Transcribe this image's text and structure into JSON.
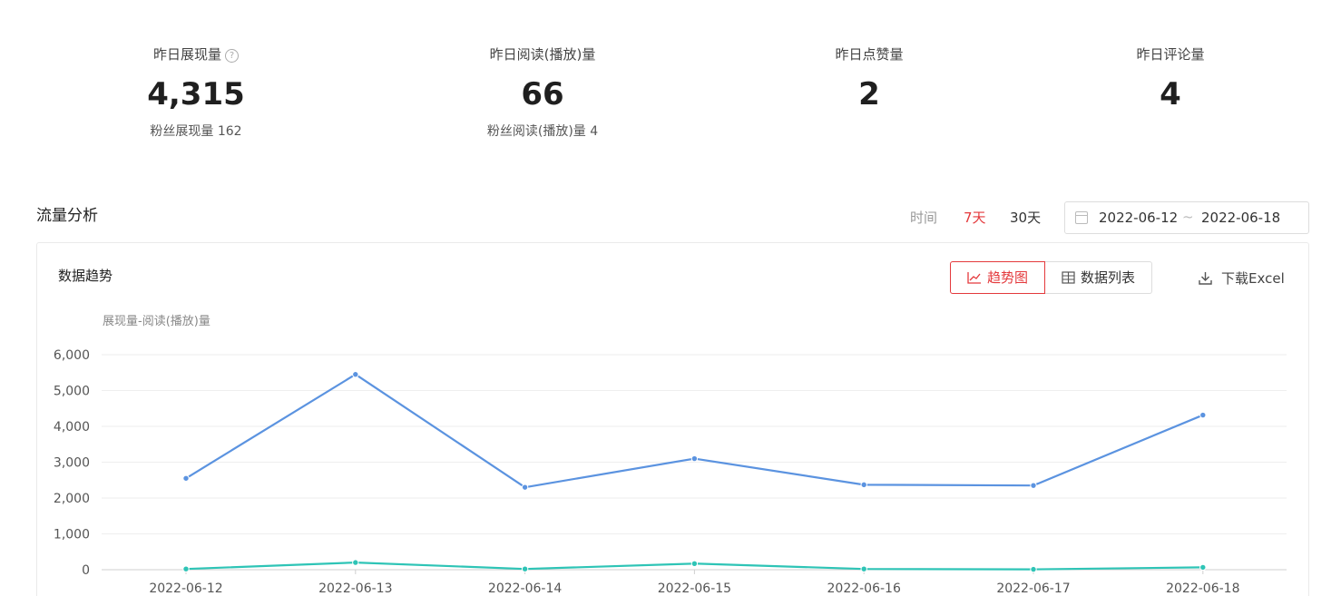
{
  "stats": [
    {
      "label": "昨日展现量",
      "value": "4,315",
      "sub": "粉丝展现量 162"
    },
    {
      "label": "昨日阅读(播放)量",
      "value": "66",
      "sub": "粉丝阅读(播放)量 4"
    },
    {
      "label": "昨日点赞量",
      "value": "2",
      "sub": ""
    },
    {
      "label": "昨日评论量",
      "value": "4",
      "sub": ""
    }
  ],
  "traffic": {
    "title": "流量分析",
    "time_label": "时间",
    "range_7": "7天",
    "range_30": "30天",
    "date_start": "2022-06-12",
    "date_sep": "~",
    "date_end": "2022-06-18"
  },
  "panel": {
    "title": "数据趋势",
    "tab_trend": "趋势图",
    "tab_list": "数据列表",
    "download": "下载Excel",
    "accent": "#e4393c"
  },
  "chart_data": {
    "type": "line",
    "ylabel": "展现量-阅读(播放)量",
    "categories": [
      "2022-06-12",
      "2022-06-13",
      "2022-06-14",
      "2022-06-15",
      "2022-06-16",
      "2022-06-17",
      "2022-06-18"
    ],
    "yticks": [
      "0",
      "1,000",
      "2,000",
      "3,000",
      "4,000",
      "5,000",
      "6,000"
    ],
    "ylim": [
      0,
      6000
    ],
    "grid": true,
    "series": [
      {
        "values": [
          2550,
          5450,
          2300,
          3100,
          2370,
          2350,
          4315
        ],
        "color": "#5b93e0"
      },
      {
        "values": [
          20,
          200,
          20,
          170,
          20,
          10,
          66
        ],
        "color": "#2ec4b6"
      }
    ]
  }
}
